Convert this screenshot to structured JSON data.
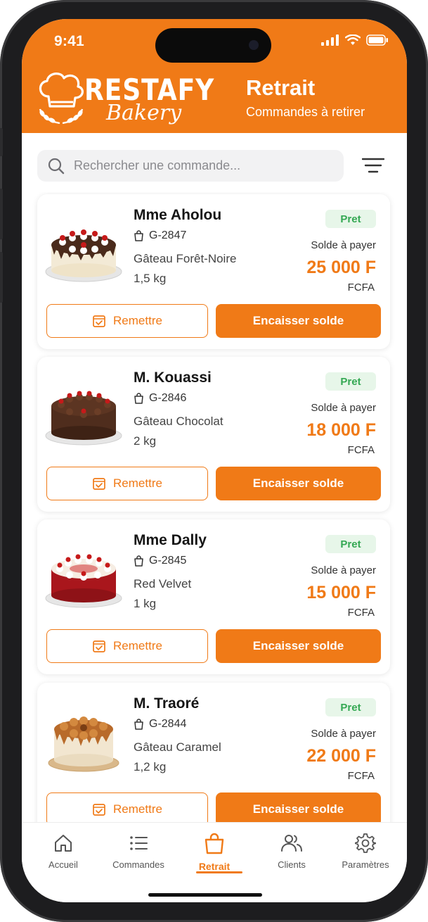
{
  "status_bar": {
    "time": "9:41"
  },
  "brand": {
    "name": "RESTAFY",
    "subtitle": "Bakery"
  },
  "header": {
    "title": "Retrait",
    "subtitle": "Commandes à retirer"
  },
  "search": {
    "placeholder": "Rechercher une commande..."
  },
  "colors": {
    "accent": "#f07a17",
    "ready_badge_bg": "#e7f6e9",
    "ready_badge_text": "#34a853"
  },
  "orders": [
    {
      "customer": "Mme Aholou",
      "ref": "G-2847",
      "product": "Gâteau Forêt-Noire",
      "weight": "1,5 kg",
      "status": "Pret",
      "balance_label": "Solde à payer",
      "amount": "25 000 F",
      "currency": "FCFA",
      "handover_label": "Remettre",
      "collect_label": "Encaisser solde",
      "cake_style": "black-forest"
    },
    {
      "customer": "M. Kouassi",
      "ref": "G-2846",
      "product": "Gâteau Chocolat",
      "weight": "2 kg",
      "status": "Pret",
      "balance_label": "Solde à payer",
      "amount": "18 000 F",
      "currency": "FCFA",
      "handover_label": "Remettre",
      "collect_label": "Encaisser solde",
      "cake_style": "chocolate"
    },
    {
      "customer": "Mme Dally",
      "ref": "G-2845",
      "product": "Red Velvet",
      "weight": "1 kg",
      "status": "Pret",
      "balance_label": "Solde à payer",
      "amount": "15 000 F",
      "currency": "FCFA",
      "handover_label": "Remettre",
      "collect_label": "Encaisser solde",
      "cake_style": "red-velvet"
    },
    {
      "customer": "M. Traoré",
      "ref": "G-2844",
      "product": "Gâteau Caramel",
      "weight": "1,2 kg",
      "status": "Pret",
      "balance_label": "Solde à payer",
      "amount": "22 000 F",
      "currency": "FCFA",
      "handover_label": "Remettre",
      "collect_label": "Encaisser solde",
      "cake_style": "caramel"
    }
  ],
  "tabs": [
    {
      "label": "Accueil",
      "icon": "home-icon",
      "active": false
    },
    {
      "label": "Commandes",
      "icon": "list-icon",
      "active": false
    },
    {
      "label": "Retrait",
      "icon": "shopping-bag-icon",
      "active": true
    },
    {
      "label": "Clients",
      "icon": "users-icon",
      "active": false
    },
    {
      "label": "Paramètres",
      "icon": "gear-icon",
      "active": false
    }
  ]
}
